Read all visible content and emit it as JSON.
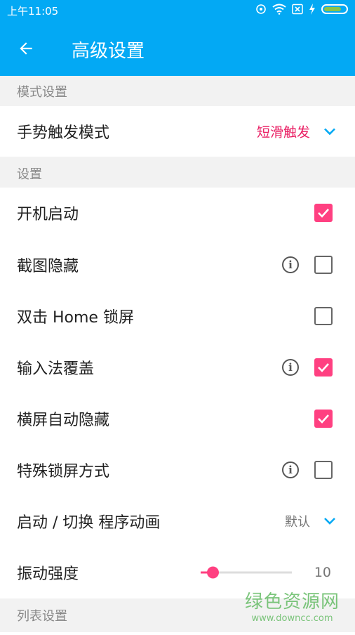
{
  "status_bar": {
    "time": "上午11:05",
    "icons": [
      "sync-icon",
      "wifi-icon",
      "sim-x-icon",
      "charging-icon",
      "battery-icon"
    ]
  },
  "app_bar": {
    "back_icon": "arrow-back-icon",
    "title": "高级设置"
  },
  "sections": [
    {
      "header": "模式设置"
    },
    {
      "header": "设置"
    },
    {
      "header": "列表设置"
    }
  ],
  "mode": {
    "gesture_trigger": {
      "label": "手势触发模式",
      "value": "短滑触发",
      "value_color": "#e91e63"
    }
  },
  "settings": {
    "boot_start": {
      "label": "开机启动",
      "checked": true
    },
    "screenshot_hide": {
      "label": "截图隐藏",
      "checked": false
    },
    "double_tap_home_lock": {
      "label": "双击 Home 锁屏",
      "checked": false
    },
    "ime_overlay": {
      "label": "输入法覆盖",
      "checked": true
    },
    "landscape_auto_hide": {
      "label": "横屏自动隐藏",
      "checked": true
    },
    "special_lock_method": {
      "label": "特殊锁屏方式",
      "checked": false
    },
    "launch_switch_animation": {
      "label": "启动 / 切换 程序动画",
      "value": "默认"
    },
    "vibration_strength": {
      "label": "振动强度",
      "value": "10"
    }
  },
  "colors": {
    "primary": "#03a9f4",
    "accent": "#ff4081",
    "dropdown_chevron": "#03a9f4"
  },
  "watermark": {
    "line1": "绿色资源网",
    "line2": "www.downcc.com"
  }
}
